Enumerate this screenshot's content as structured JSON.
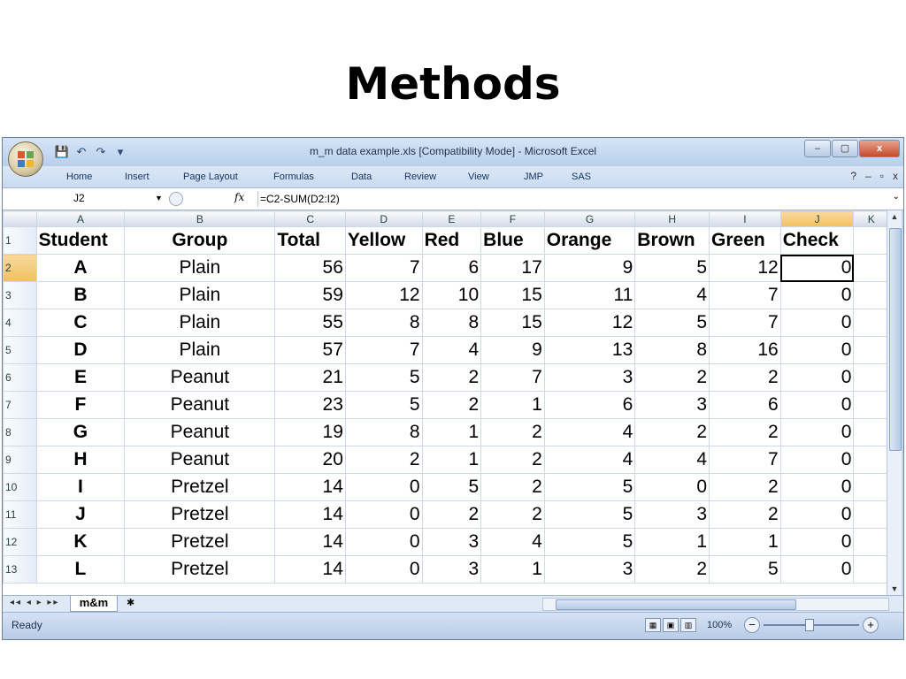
{
  "slide": {
    "title": "Methods"
  },
  "window": {
    "title": "m_m data example.xls  [Compatibility Mode] - Microsoft Excel",
    "minimize": "–",
    "restore": "▢",
    "close": "x"
  },
  "qat": {
    "save": "💾",
    "undo": "↶",
    "redo": "↷",
    "dropdown": "▾"
  },
  "ribbon": {
    "tabs": [
      "Home",
      "Insert",
      "Page Layout",
      "Formulas",
      "Data",
      "Review",
      "View",
      "JMP",
      "SAS"
    ],
    "help": "?",
    "min": "–",
    "restore": "▫",
    "close": "x"
  },
  "formula_bar": {
    "name_box": "J2",
    "fx": "fx",
    "formula": "=C2-SUM(D2:I2)"
  },
  "columns": [
    "A",
    "B",
    "C",
    "D",
    "E",
    "F",
    "G",
    "H",
    "I",
    "J",
    "K"
  ],
  "header_row": [
    "Student",
    "Group",
    "Total",
    "Yellow",
    "Red",
    "Blue",
    "Orange",
    "Brown",
    "Green",
    "Check"
  ],
  "rows": [
    {
      "n": "2",
      "cells": [
        "A",
        "Plain",
        "56",
        "7",
        "6",
        "17",
        "9",
        "5",
        "12",
        "0"
      ]
    },
    {
      "n": "3",
      "cells": [
        "B",
        "Plain",
        "59",
        "12",
        "10",
        "15",
        "11",
        "4",
        "7",
        "0"
      ]
    },
    {
      "n": "4",
      "cells": [
        "C",
        "Plain",
        "55",
        "8",
        "8",
        "15",
        "12",
        "5",
        "7",
        "0"
      ]
    },
    {
      "n": "5",
      "cells": [
        "D",
        "Plain",
        "57",
        "7",
        "4",
        "9",
        "13",
        "8",
        "16",
        "0"
      ]
    },
    {
      "n": "6",
      "cells": [
        "E",
        "Peanut",
        "21",
        "5",
        "2",
        "7",
        "3",
        "2",
        "2",
        "0"
      ]
    },
    {
      "n": "7",
      "cells": [
        "F",
        "Peanut",
        "23",
        "5",
        "2",
        "1",
        "6",
        "3",
        "6",
        "0"
      ]
    },
    {
      "n": "8",
      "cells": [
        "G",
        "Peanut",
        "19",
        "8",
        "1",
        "2",
        "4",
        "2",
        "2",
        "0"
      ]
    },
    {
      "n": "9",
      "cells": [
        "H",
        "Peanut",
        "20",
        "2",
        "1",
        "2",
        "4",
        "4",
        "7",
        "0"
      ]
    },
    {
      "n": "10",
      "cells": [
        "I",
        "Pretzel",
        "14",
        "0",
        "5",
        "2",
        "5",
        "0",
        "2",
        "0"
      ]
    },
    {
      "n": "11",
      "cells": [
        "J",
        "Pretzel",
        "14",
        "0",
        "2",
        "2",
        "5",
        "3",
        "2",
        "0"
      ]
    },
    {
      "n": "12",
      "cells": [
        "K",
        "Pretzel",
        "14",
        "0",
        "3",
        "4",
        "5",
        "1",
        "1",
        "0"
      ]
    },
    {
      "n": "13",
      "cells": [
        "L",
        "Pretzel",
        "14",
        "0",
        "3",
        "1",
        "3",
        "2",
        "5",
        "0"
      ]
    }
  ],
  "sheets": {
    "nav": "◂◂ ◂ ▸ ▸▸",
    "active": "m&m",
    "add": "✱"
  },
  "status": {
    "text": "Ready",
    "zoom": "100%",
    "minus": "−",
    "plus": "+"
  },
  "colors": {
    "selected_header": "#f1c15f",
    "chrome": "#c5d7ee"
  }
}
